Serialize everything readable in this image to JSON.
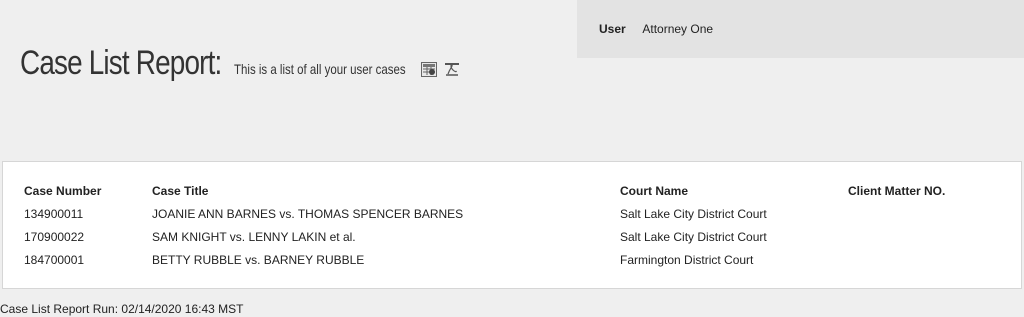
{
  "user_panel": {
    "label": "User",
    "value": "Attorney One"
  },
  "header": {
    "title": "Case List Report:",
    "subtitle": "This is a list of all your user cases",
    "icons": [
      "spreadsheet-export-icon",
      "pdf-export-icon"
    ]
  },
  "table": {
    "columns": [
      "Case Number",
      "Case Title",
      "Court Name",
      "Client Matter NO."
    ],
    "rows": [
      {
        "case_number": "134900011",
        "case_title": "JOANIE ANN BARNES vs. THOMAS SPENCER BARNES",
        "court_name": "Salt Lake City District Court",
        "client_matter": ""
      },
      {
        "case_number": "170900022",
        "case_title": "SAM KNIGHT vs. LENNY LAKIN et al.",
        "court_name": "Salt Lake City District Court",
        "client_matter": ""
      },
      {
        "case_number": "184700001",
        "case_title": "BETTY RUBBLE vs. BARNEY RUBBLE",
        "court_name": "Farmington District Court",
        "client_matter": ""
      }
    ]
  },
  "footer": {
    "run_text": "Case List Report Run: 02/14/2020 16:43 MST"
  }
}
